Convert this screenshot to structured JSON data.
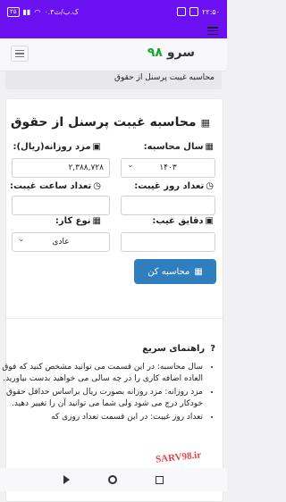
{
  "status_bar": {
    "time": "۲۲:۵۰",
    "speed": "۰.۳ک.ب/ث",
    "battery": "۲۵"
  },
  "brand": {
    "name": "سرو",
    "number": "۹۸"
  },
  "breadcrumb": "محاسبه غیبت پرسنل از حقوق",
  "form": {
    "title": "محاسبه غیبت پرسنل از حقوق",
    "year_label": "سال محاسبه:",
    "year_value": "۱۴۰۳",
    "salary_label": "مزد روزانه(ریال):",
    "salary_value": "۲,۳۸۸,۷۲۸",
    "days_label": "تعداد روز غیبت:",
    "hours_label": "تعداد ساعت غیبت:",
    "minutes_label": "دقایق غیب:",
    "worktype_label": "نوع کار:",
    "worktype_value": "عادی",
    "calc_button": "محاسبه کن"
  },
  "help": {
    "title": "راهنمای سریع",
    "items": [
      "سال محاسبه: در این قسمت می توانید مشخص کنید که فوق العاده اضافه کاری را در چه سالی می خواهید بدست بیاورید.",
      "مزد روزانه: مزد روزانه بصورت ریال براساس حداقل حقوق خودکار درج می شود ولی شما می توانید آن را تغییر دهید.",
      "تعداد روز غیبت: در این قسمت تعداد روزی که"
    ]
  },
  "watermark": "SARV98.ir"
}
